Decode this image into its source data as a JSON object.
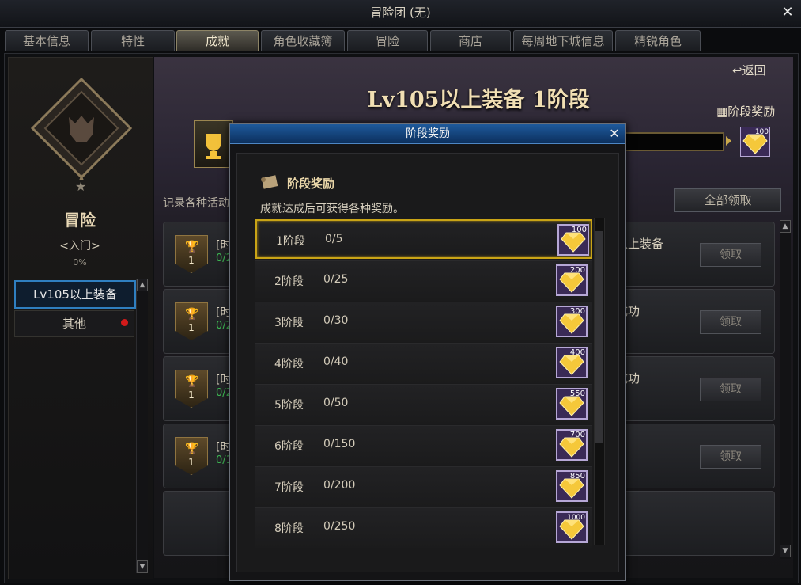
{
  "window": {
    "title": "冒险团 (无)",
    "close_glyph": "✕"
  },
  "tabs": [
    "基本信息",
    "特性",
    "成就",
    "角色收藏簿",
    "冒险",
    "商店",
    "每周地下城信息",
    "精锐角色"
  ],
  "active_tab": "成就",
  "sidebar": {
    "category_name": "冒险",
    "level": "<入门>",
    "percent": "0%",
    "items": [
      {
        "label": "Lv105以上装备",
        "active": true
      },
      {
        "label": "其他",
        "alert": true
      }
    ]
  },
  "header": {
    "back_label": "返回",
    "stage_title": "Lv105以上装备 1阶段",
    "stage_reward_label": "阶段奖励",
    "top_reward_count": "100"
  },
  "main": {
    "description": "记录各种活动",
    "claim_all_label": "全部领取",
    "achievements": [
      {
        "badge": "1",
        "name": "[时",
        "progress": "0/2",
        "right_text": "以上装备",
        "button": "领取"
      },
      {
        "badge": "1",
        "name": "[时",
        "progress": "0/2",
        "right_text": "成功",
        "button": "领取"
      },
      {
        "badge": "1",
        "name": "[时",
        "progress": "0/2",
        "right_text": "成功",
        "button": "领取"
      },
      {
        "badge": "1",
        "name": "[时",
        "progress": "0/1",
        "right_text": "",
        "button": "领取"
      }
    ]
  },
  "modal": {
    "title": "阶段奖励",
    "heading": "阶段奖励",
    "subtitle": "成就达成后可获得各种奖励。",
    "stages": [
      {
        "label": "1阶段",
        "progress": "0/5",
        "reward": "100"
      },
      {
        "label": "2阶段",
        "progress": "0/25",
        "reward": "200"
      },
      {
        "label": "3阶段",
        "progress": "0/30",
        "reward": "300"
      },
      {
        "label": "4阶段",
        "progress": "0/40",
        "reward": "400"
      },
      {
        "label": "5阶段",
        "progress": "0/50",
        "reward": "550"
      },
      {
        "label": "6阶段",
        "progress": "0/150",
        "reward": "700"
      },
      {
        "label": "7阶段",
        "progress": "0/200",
        "reward": "850"
      },
      {
        "label": "8阶段",
        "progress": "0/250",
        "reward": "1000"
      }
    ]
  },
  "colors": {
    "accent_gold": "#c9a416",
    "modal_header": "#1e5a9c",
    "progress_green": "#3fbf55"
  }
}
